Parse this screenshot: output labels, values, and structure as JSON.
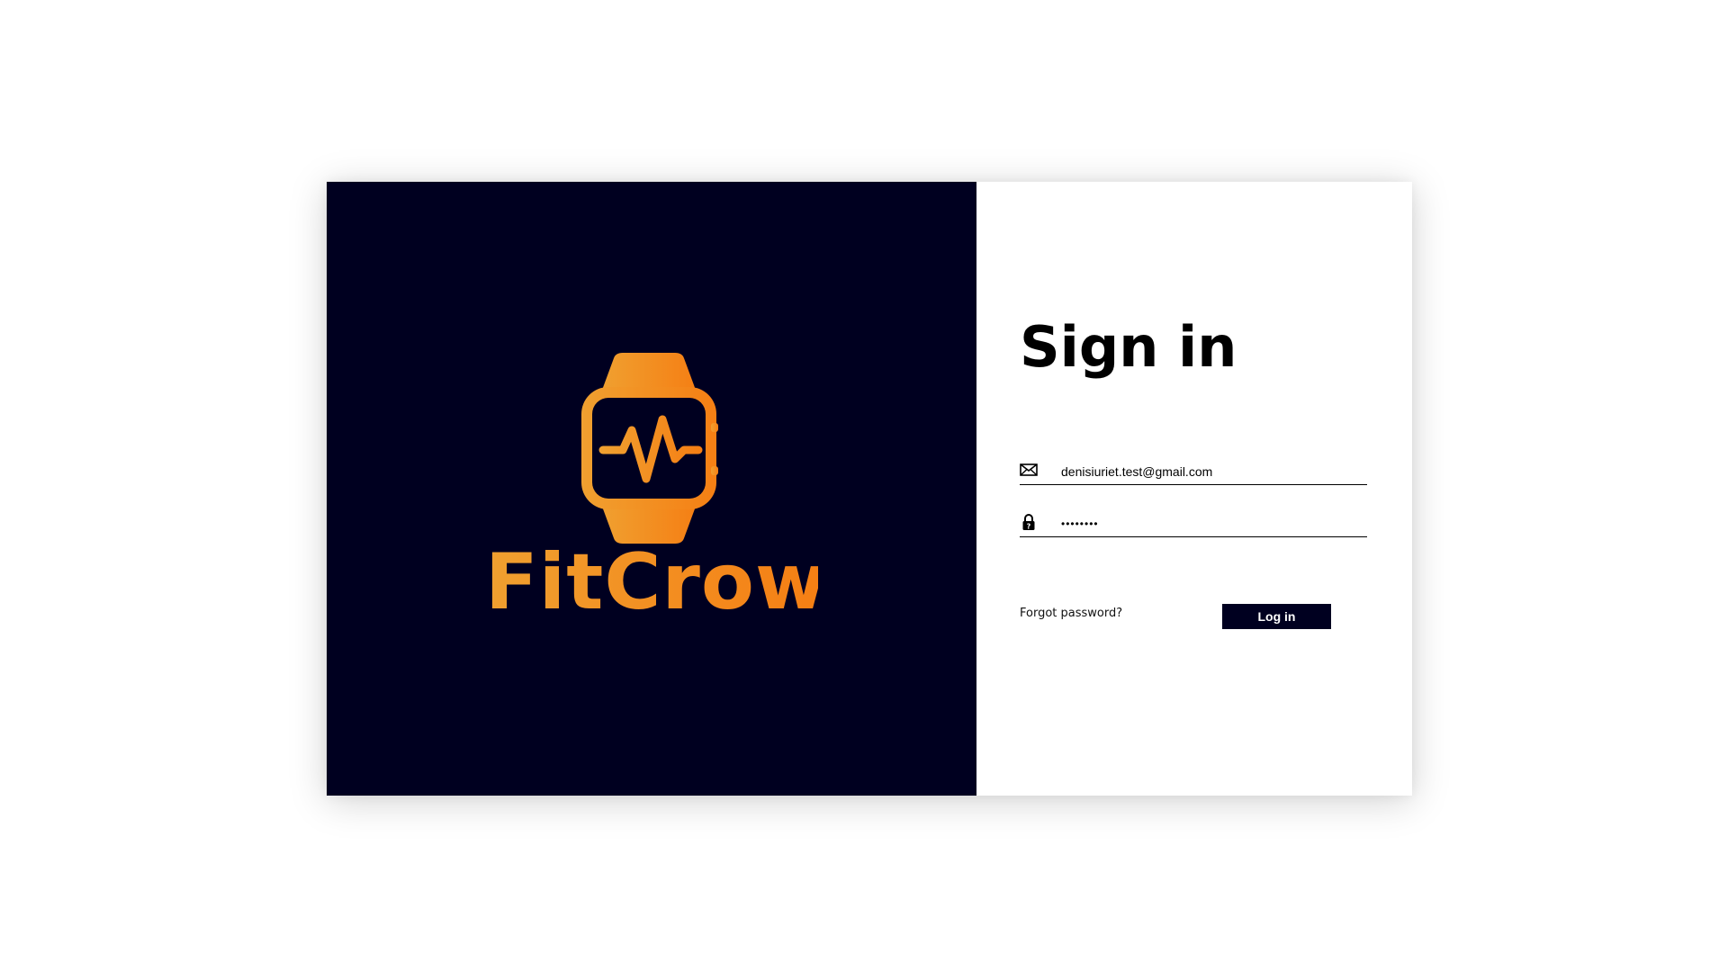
{
  "brand": {
    "name": "FitCrowd",
    "logo_icon": "smartwatch-heartbeat-icon",
    "colors": {
      "panel_background": "#000020",
      "accent_light": "#f0a030",
      "accent_dark": "#f57f14"
    }
  },
  "signin": {
    "title": "Sign in",
    "email": {
      "icon": "envelope-icon",
      "value": "denisiuriet.test@gmail.com"
    },
    "password": {
      "icon": "lock-icon",
      "value": "••••••••"
    },
    "forgot_password_label": "Forgot password?",
    "login_button_label": "Log in",
    "button_color": "#000020"
  }
}
